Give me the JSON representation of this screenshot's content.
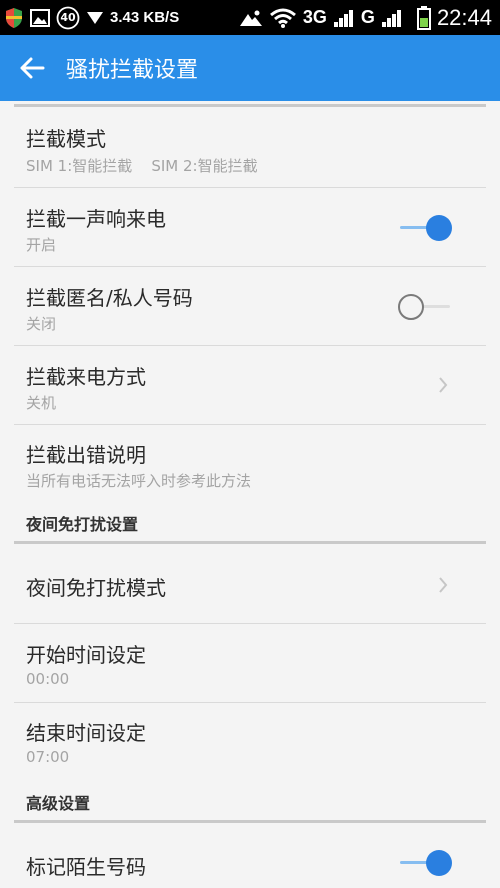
{
  "status_bar": {
    "notification_count": "40",
    "speed": "3.43 KB/S",
    "network1": "3G",
    "network2": "G",
    "time": "22:44"
  },
  "app_bar": {
    "title": "骚扰拦截设置"
  },
  "settings": {
    "intercept_mode": {
      "title": "拦截模式",
      "subtitle": "SIM 1:智能拦截    SIM 2:智能拦截"
    },
    "ring_once": {
      "title": "拦截一声响来电",
      "subtitle": "开启",
      "enabled": true
    },
    "anonymous": {
      "title": "拦截匿名/私人号码",
      "subtitle": "关闭",
      "enabled": false
    },
    "intercept_method": {
      "title": "拦截来电方式",
      "subtitle": "关机"
    },
    "error_help": {
      "title": "拦截出错说明",
      "subtitle": "当所有电话无法呼入时参考此方法"
    }
  },
  "night_section": {
    "header": "夜间免打扰设置",
    "mode": {
      "title": "夜间免打扰模式"
    },
    "start": {
      "title": "开始时间设定",
      "value": "00:00"
    },
    "end": {
      "title": "结束时间设定",
      "value": "07:00"
    }
  },
  "advanced_section": {
    "header": "高级设置",
    "mark_stranger": {
      "title": "标记陌生号码",
      "enabled": true
    }
  }
}
